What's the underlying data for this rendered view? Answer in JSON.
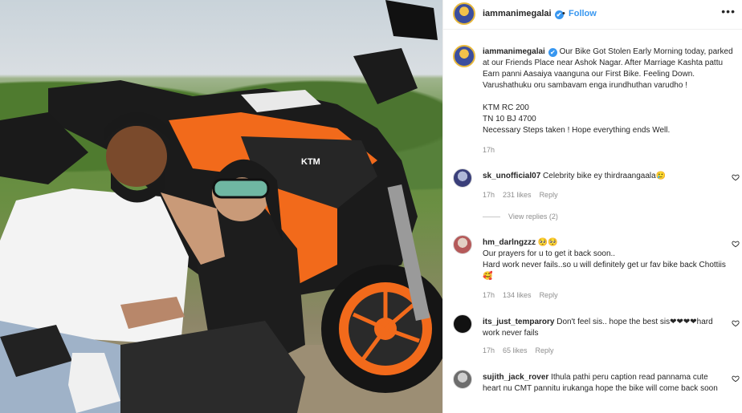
{
  "post": {
    "photo_alt": "Couple posing beside orange KTM RC motorcycle",
    "bike_brand_text": "KTM"
  },
  "header": {
    "username": "iammanimegalai",
    "verified_mark": "✔",
    "separator": "•",
    "follow_label": "Follow",
    "more_label": "•••"
  },
  "caption": {
    "username": "iammanimegalai",
    "verified_mark": "✔",
    "text": "Our Bike Got Stolen Early Morning today, parked at our Friends Place near Ashok Nagar. After Marriage Kashta pattu Earn panni Aasaiya vaanguna our First Bike. Feeling Down. Varushathuku oru sambavam enga irundhuthan varudho !",
    "line1": "KTM RC 200",
    "line2": "TN 10 BJ 4700",
    "line3": "Necessary Steps taken ! Hope everything ends Well.",
    "time": "17h"
  },
  "comments": [
    {
      "username": "sk_unofficial07",
      "text": "Celebrity bike ey thirdraangaala🥲",
      "time": "17h",
      "likes": "231 likes",
      "reply": "Reply",
      "view_replies": "View replies (2)"
    },
    {
      "username": "hm_darlngzzz",
      "text": "🥺🥺",
      "text2": "Our prayers for u to get it back soon..",
      "text3": "Hard work never fails..so u will definitely get ur fav bike back Chottiis🥰",
      "time": "17h",
      "likes": "134 likes",
      "reply": "Reply"
    },
    {
      "username": "its_just_temparory",
      "text": "Don't feel sis.. hope the best sis❤❤❤❤hard work never fails",
      "time": "17h",
      "likes": "65 likes",
      "reply": "Reply"
    },
    {
      "username": "sujith_jack_rover",
      "text": "Ithula pathi peru caption read pannama cute heart nu CMT pannitu irukanga hope the bike will come back soon"
    }
  ],
  "icons": {
    "heart": "heart-outline-icon"
  },
  "colors": {
    "link_blue": "#3897f0",
    "text_dark": "#262626",
    "text_muted": "#8e8e8e",
    "bike_orange": "#f26a1b"
  }
}
